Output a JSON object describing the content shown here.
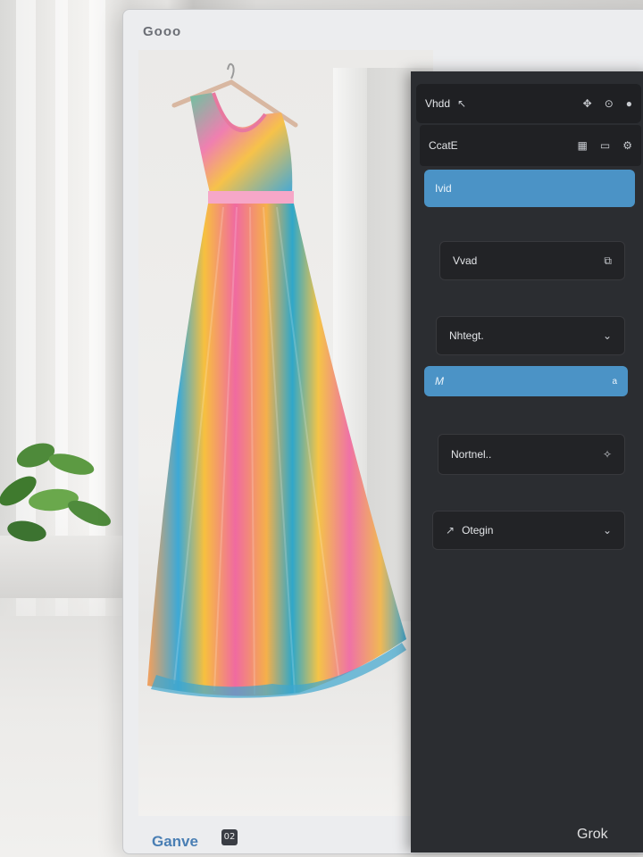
{
  "monitor": {
    "brand": "Gooo",
    "canvas_brand": "Ganve",
    "canvas_brand_icon": "02"
  },
  "panel": {
    "top_row": {
      "label": "Vhdd",
      "icon": "cursor-icon"
    },
    "header": {
      "label": "CcatE",
      "icons": [
        "grid-icon",
        "image-icon",
        "settings-icon"
      ]
    },
    "rows": [
      {
        "label": "Ivid",
        "style": "blue"
      },
      {
        "label": "Vvad",
        "style": "field",
        "trailing": "copy-icon"
      },
      {
        "label": "Nhtegt.",
        "style": "field",
        "trailing": "chevron-down-icon"
      },
      {
        "label": "M",
        "style": "blue",
        "trailing": "a"
      },
      {
        "label": "Nortnel..",
        "style": "field",
        "trailing": "sparkle-icon"
      },
      {
        "label": "Otegin",
        "style": "field",
        "leading": "wand-icon",
        "trailing": "chevron-down-icon"
      }
    ]
  },
  "watermark": "Grok",
  "colors": {
    "panel_bg": "#2b2d31",
    "accent_blue": "#4b93c6",
    "brand_blue": "#4a7fb4"
  }
}
